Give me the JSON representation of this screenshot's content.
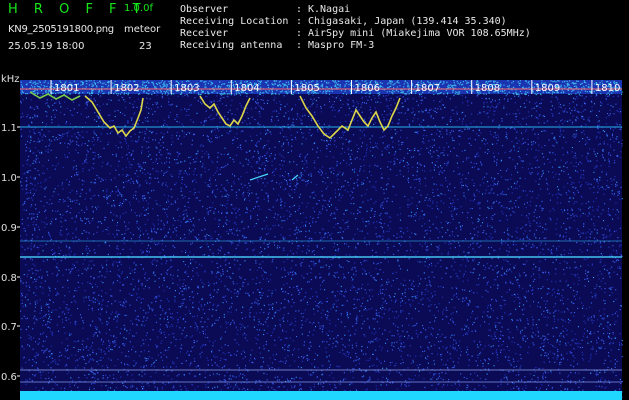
{
  "header": {
    "app_name": "H R O F F T",
    "version": "1.0.0f",
    "file_name": "KN9_2505191800.png",
    "timestamp": "25.05.19 18:00",
    "meteor_label": "meteor",
    "meteor_count": "23"
  },
  "info": [
    {
      "key": "Observer",
      "sep": ":",
      "value": "K.Nagai"
    },
    {
      "key": "Receiving Location",
      "sep": ":",
      "value": "Chigasaki, Japan (139.414 35.340)"
    },
    {
      "key": "Receiver",
      "sep": ":",
      "value": "AirSpy mini (Miakejima VOR 108.65MHz)"
    },
    {
      "key": "Receiving antenna",
      "sep": ":",
      "value": "Maspro FM-3"
    }
  ],
  "axis": {
    "unit": "kHz",
    "ticks": [
      "1.1",
      "1.0",
      "0.9",
      "0.8",
      "0.7",
      "0.6"
    ],
    "time_labels": [
      "1801",
      "1802",
      "1803",
      "1804",
      "1805",
      "1806",
      "1807",
      "1808",
      "1809",
      "1810"
    ]
  },
  "colors": {
    "background": "#0a0a55",
    "noise_blue": "#2a3dd8",
    "noise_cyan": "#35c0ff",
    "trace_yellow": "#e8e24a",
    "trace_green": "#7bd04a",
    "reference_line": "#4bd8ff",
    "header_text": "#e8e8e8",
    "brand_green": "#17e81a"
  }
}
